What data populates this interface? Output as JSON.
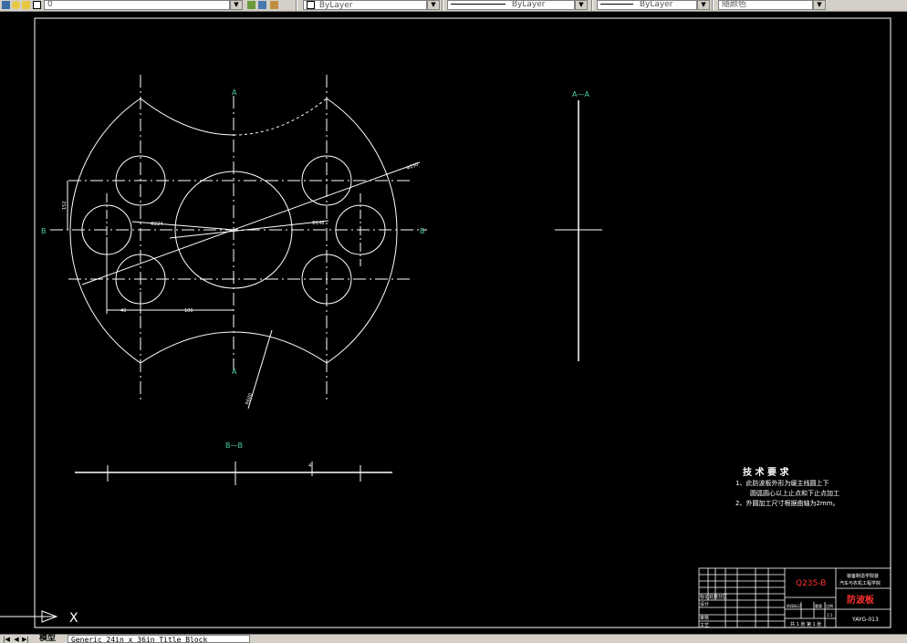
{
  "toolbar": {
    "layer_value": "0",
    "color_value": "ByLayer",
    "linetype_value": "ByLayer",
    "lineweight_value": "ByLayer",
    "plotstyle_value": "随颜色"
  },
  "drawing": {
    "section_label_A_top": "A",
    "section_label_A_bottom": "A",
    "section_label_B_left": "B",
    "section_label_B_right": "B",
    "section_view_AA_title": "A—A",
    "section_view_BB_title": "B—B",
    "dim_phi_large": "Φ230",
    "dim_phi_mid": "Φ224",
    "dim_phi_small": "Φ146",
    "dim_vertical": "152",
    "dim_bottom_left": "40",
    "dim_bottom_mid": "106",
    "dim_radius": "R600",
    "dim_bb_thickness": "4"
  },
  "tech_requirements": {
    "title": "技 术 要 求",
    "line1": "1、此防波板外形为缓主线圆上下",
    "line2": "圆弧圆心以上止点和下止点加工",
    "line3": "2、外圆加工尺寸根据曲轴为2mm。"
  },
  "title_block": {
    "material": "Q235-B",
    "school_line1": "装备制造学院装",
    "school_line2": "汽车与农机工程学院",
    "part_name": "防波板",
    "drawing_number": "YAYG-013",
    "label_mark": "标记处数分区",
    "label_design": "设计",
    "label_review": "审核",
    "label_process": "工艺",
    "label_stage": "阶段标记",
    "label_weight": "重量",
    "label_scale": "比例",
    "sheet_info": "共 1 张 第 1 张",
    "scale_value": "1:1"
  },
  "command_line": {
    "prompt_x": "X"
  },
  "statusbar": {
    "model_tab": "模型",
    "layout_tab": "Generic 24in x 36in Title Block"
  },
  "colors": {
    "background": "#000000",
    "line": "#ffffff",
    "label_green": "#4fd0a0",
    "material_red": "#ff3030",
    "ui_gray": "#d4d0c8"
  }
}
